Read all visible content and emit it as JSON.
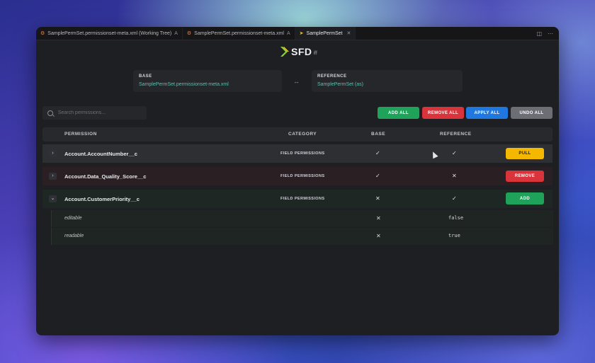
{
  "tabs": [
    {
      "label": "SamplePermSet.permissionset-meta.xml (Working Tree)",
      "note": "A",
      "icon": "xml-file-icon"
    },
    {
      "label": "SamplePermSet.permissionset-meta.xml",
      "note": "A",
      "icon": "xml-file-icon"
    },
    {
      "label": "SamplePermSet",
      "note": "",
      "icon": "sfdiff-icon",
      "active": true
    }
  ],
  "logo": {
    "text": "SFD",
    "suffix": "iff"
  },
  "base": {
    "label": "BASE",
    "value": "SamplePermSet.permissionset-meta.xml"
  },
  "reference": {
    "label": "REFERENCE",
    "value": "SamplePermSet (as)"
  },
  "search": {
    "placeholder": "Search permissions..."
  },
  "actions": {
    "add_all": {
      "label": "ADD ALL",
      "color": "#1fa35a"
    },
    "remove_all": {
      "label": "REMOVE ALL",
      "color": "#d9343c"
    },
    "apply_all": {
      "label": "APPLY ALL",
      "color": "#1f78e0"
    },
    "undo_all": {
      "label": "UNDO ALL",
      "color": "#6b6e75"
    }
  },
  "columns": {
    "permission": "PERMISSION",
    "category": "CATEGORY",
    "base": "BASE",
    "reference": "REFERENCE"
  },
  "rows": [
    {
      "name": "Account.AccountNumber__c",
      "category": "FIELD PERMISSIONS",
      "base": "✓",
      "reference": "✓",
      "action": "PULL",
      "action_color": "#f5b800",
      "expanded": false
    },
    {
      "name": "Account.Data_Quality_Score__c",
      "category": "FIELD PERMISSIONS",
      "base": "✓",
      "reference": "✕",
      "action": "REMOVE",
      "action_color": "#d9343c",
      "expanded": false
    },
    {
      "name": "Account.CustomerPriority__c",
      "category": "FIELD PERMISSIONS",
      "base": "✕",
      "reference": "✓",
      "action": "ADD",
      "action_color": "#1fa35a",
      "expanded": true,
      "children": [
        {
          "name": "editable",
          "base": "✕",
          "reference": "false"
        },
        {
          "name": "readable",
          "base": "✕",
          "reference": "true"
        }
      ]
    }
  ],
  "icons": {
    "expand": "chevron-right-icon",
    "collapse": "chevron-down-icon",
    "split": "split-editor-icon",
    "more": "more-icon"
  }
}
